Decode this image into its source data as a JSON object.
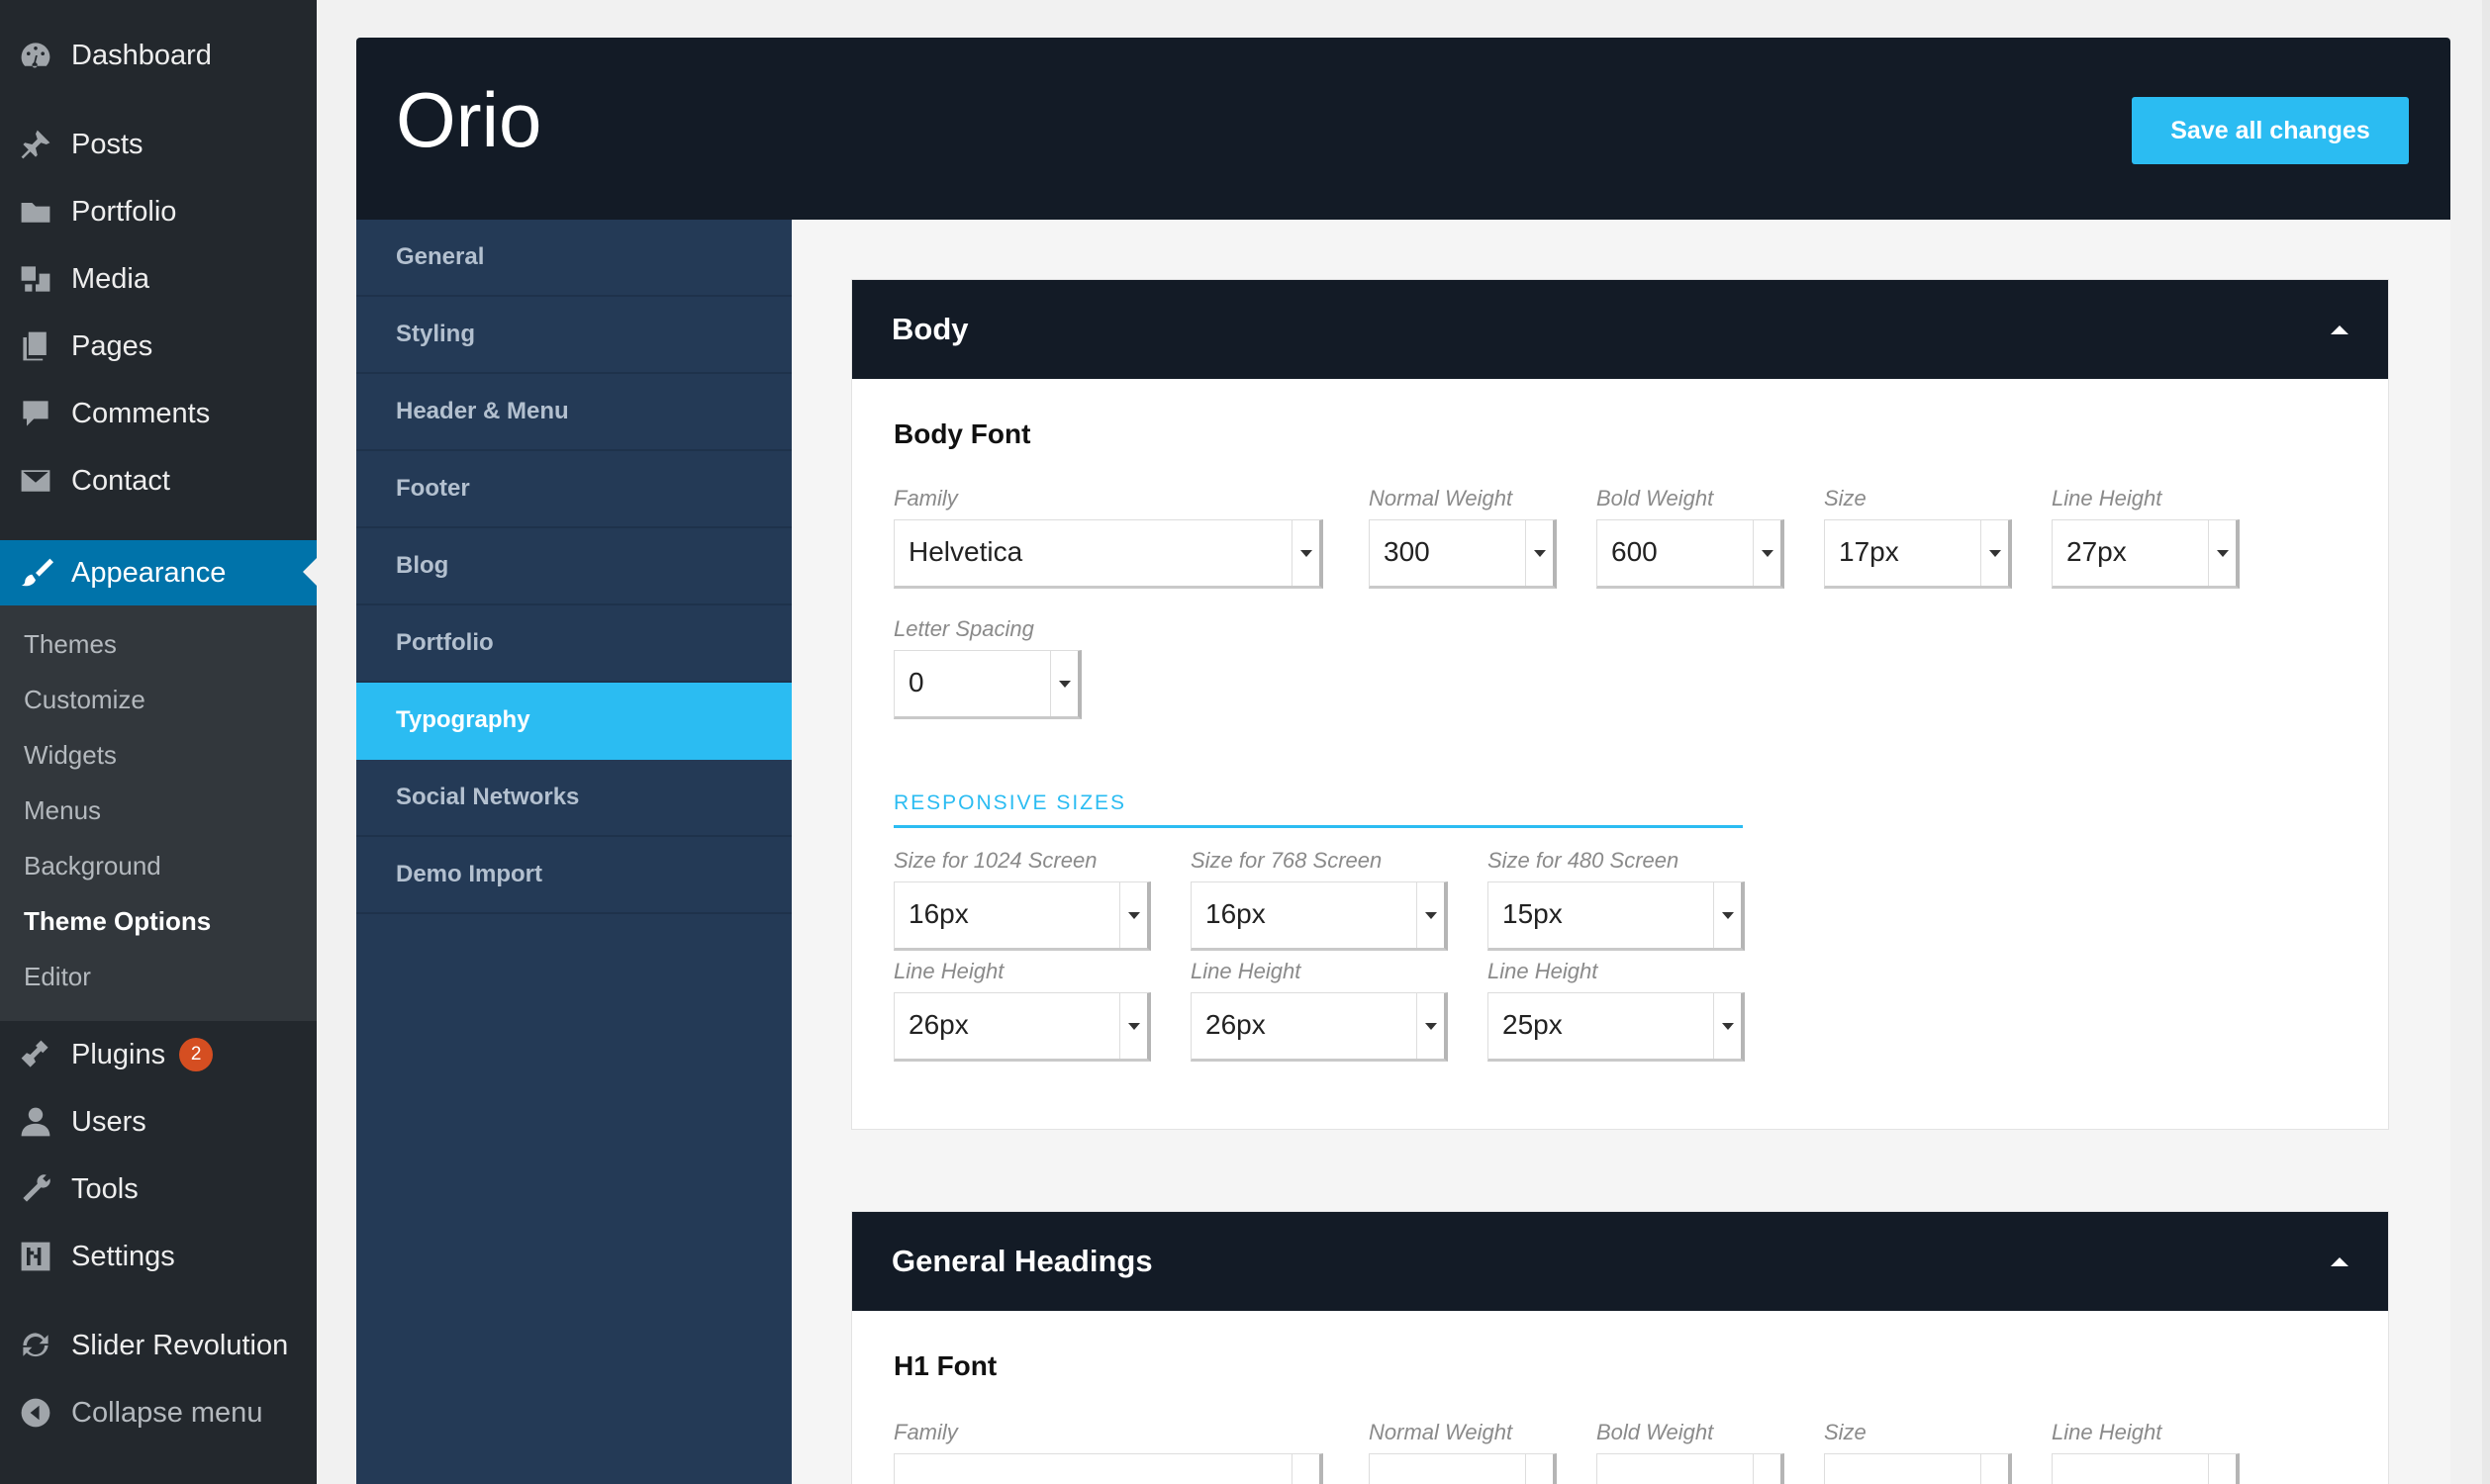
{
  "admin_menu": {
    "items": [
      {
        "label": "Dashboard",
        "icon": "dashboard-icon"
      },
      {
        "label": "Posts",
        "icon": "pin-icon"
      },
      {
        "label": "Portfolio",
        "icon": "folder-icon"
      },
      {
        "label": "Media",
        "icon": "media-icon"
      },
      {
        "label": "Pages",
        "icon": "pages-icon"
      },
      {
        "label": "Comments",
        "icon": "comment-icon"
      },
      {
        "label": "Contact",
        "icon": "envelope-icon"
      },
      {
        "label": "Appearance",
        "icon": "paintbrush-icon"
      },
      {
        "label": "Plugins",
        "icon": "plug-icon",
        "badge": "2"
      },
      {
        "label": "Users",
        "icon": "user-icon"
      },
      {
        "label": "Tools",
        "icon": "wrench-icon"
      },
      {
        "label": "Settings",
        "icon": "settings-icon"
      },
      {
        "label": "Slider Revolution",
        "icon": "refresh-icon"
      },
      {
        "label": "Collapse menu",
        "icon": "collapse-icon"
      }
    ],
    "submenu": [
      "Themes",
      "Customize",
      "Widgets",
      "Menus",
      "Background",
      "Theme Options",
      "Editor"
    ]
  },
  "panel": {
    "title": "Orio",
    "save_label": "Save all changes",
    "nav": [
      "General",
      "Styling",
      "Header & Menu",
      "Footer",
      "Blog",
      "Portfolio",
      "Typography",
      "Social Networks",
      "Demo Import"
    ],
    "active_nav": "Typography"
  },
  "body_section": {
    "title": "Body",
    "group": "Body Font",
    "fields": [
      {
        "label": "Family",
        "value": "Helvetica"
      },
      {
        "label": "Normal Weight",
        "value": "300"
      },
      {
        "label": "Bold Weight",
        "value": "600"
      },
      {
        "label": "Size",
        "value": "17px"
      },
      {
        "label": "Line Height",
        "value": "27px"
      }
    ],
    "letter_spacing": {
      "label": "Letter Spacing",
      "value": "0"
    },
    "responsive_title": "RESPONSIVE SIZES",
    "responsive": [
      {
        "size_label": "Size for 1024 Screen",
        "size": "16px",
        "lh_label": "Line Height",
        "lh": "26px"
      },
      {
        "size_label": "Size for 768 Screen",
        "size": "16px",
        "lh_label": "Line Height",
        "lh": "26px"
      },
      {
        "size_label": "Size for 480 Screen",
        "size": "15px",
        "lh_label": "Line Height",
        "lh": "25px"
      }
    ]
  },
  "headings_section": {
    "title": "General Headings",
    "group": "H1 Font",
    "labels": [
      "Family",
      "Normal Weight",
      "Bold Weight",
      "Size",
      "Line Height"
    ]
  },
  "colors": {
    "accent": "#2bbcf2",
    "header_bg": "#131b26",
    "nav_bg": "#243a56",
    "wp_menu": "#23282d",
    "wp_current": "#0073aa"
  }
}
